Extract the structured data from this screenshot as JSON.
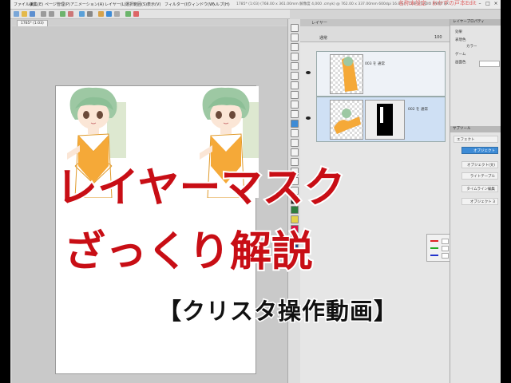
{
  "window": {
    "title": "1785* (1:03) (768.00 x 361.00mm 解像度 4,000 .cmyk) @ 762.00 x 337.00mm 600dpi 16.0%) - CLIP STUDIO PAINT EX",
    "app_name": "名称未設定 - おかずの戸本Edit",
    "menu": [
      "ファイル(F)",
      "編集(E)",
      "ページ管理(P)",
      "アニメーション(A)",
      "レイヤー(L)",
      "選択範囲(S)",
      "表示(V)",
      "フィルター(I)",
      "ウィンドウ(W)",
      "ヘルプ(H)"
    ]
  },
  "canvas": {
    "tab_label": "1785* (1:03)",
    "accent": "#c80e15"
  },
  "layer_panel": {
    "title": "レイヤー",
    "blend_mode": "通常",
    "opacity": "100",
    "layers": [
      {
        "name": "003 を 通常"
      },
      {
        "name": "002 を 通常"
      }
    ]
  },
  "right_panel": {
    "tool_property_title": "レイヤープロパティ",
    "effect_label": "効果",
    "expression_label": "表現色",
    "expression_value": "カラー",
    "subtitle_label": "ゲーム",
    "sub_label2": "画面色",
    "sub_panel_title": "サブツール",
    "sub_panel_header": "エフェクト",
    "items": [
      "オブジェクト",
      "オブジェクト(文)",
      "ライトテーブル",
      "タイムライン編集",
      "オブジェクト 3"
    ]
  },
  "overlay": {
    "title_line1": "レイヤーマスク",
    "title_line2": "ざっくり解説",
    "subtitle": "【クリスタ操作動画】"
  }
}
